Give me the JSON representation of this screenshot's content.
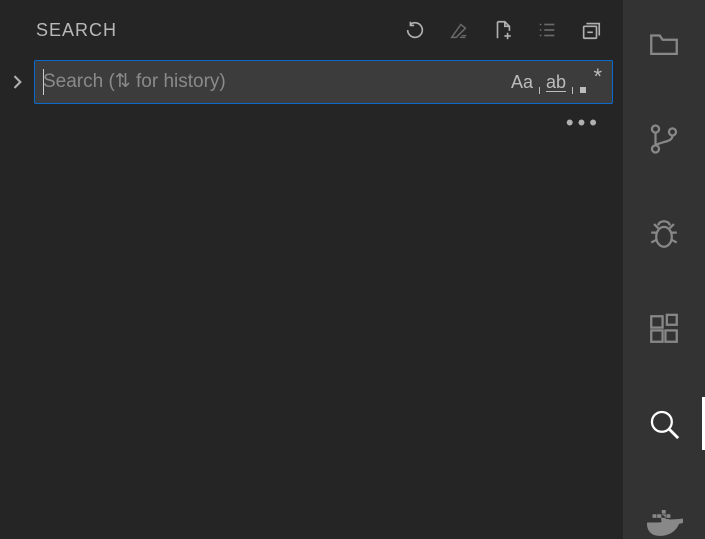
{
  "panel": {
    "title": "SEARCH"
  },
  "search": {
    "placeholder": "Search (⇅ for history)",
    "value": "",
    "matchCaseLabel": "Aa",
    "wholeWordLabel": "ab",
    "moreLabel": "⋯"
  },
  "icons": {
    "refresh": "refresh-icon",
    "clear": "clear-results-icon",
    "newFile": "new-file-icon",
    "viewAsList": "view-list-icon",
    "collapse": "collapse-all-icon",
    "chevron": "chevron-right-icon",
    "regex": "regex-icon"
  },
  "activityBar": {
    "items": [
      {
        "name": "explorer",
        "active": false
      },
      {
        "name": "source-control",
        "active": false
      },
      {
        "name": "debug",
        "active": false
      },
      {
        "name": "extensions",
        "active": false
      },
      {
        "name": "search",
        "active": true
      },
      {
        "name": "docker",
        "active": false
      }
    ]
  }
}
